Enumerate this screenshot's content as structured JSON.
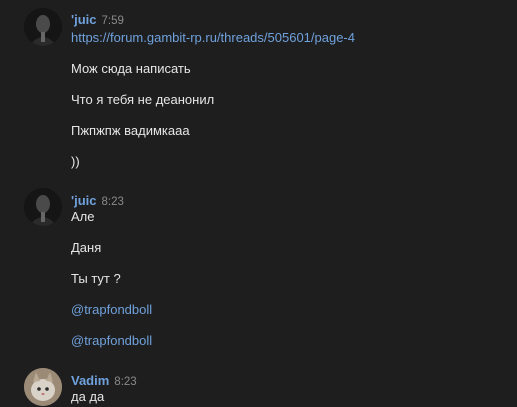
{
  "messages": [
    {
      "author": "'juic",
      "time": "7:59",
      "lines": [
        "https://forum.gambit-rp.ru/threads/505601/page-4",
        "Мож сюда написать",
        "Что я тебя не деанонил",
        "Пжпжпж вадимкааа",
        "))"
      ]
    },
    {
      "author": "'juic",
      "time": "8:23",
      "lines": [
        "Але",
        "Даня",
        "Ты тут ?",
        "@trapfondboll",
        "@trapfondboll"
      ]
    },
    {
      "author": "Vadim",
      "time": "8:23",
      "lines": [
        "да да"
      ]
    }
  ],
  "colors": {
    "background": "#1e1e1e",
    "author": "#6fa1dc",
    "link": "#6fa1dc",
    "text": "#e6e6e6",
    "time": "#8a8a8a"
  }
}
